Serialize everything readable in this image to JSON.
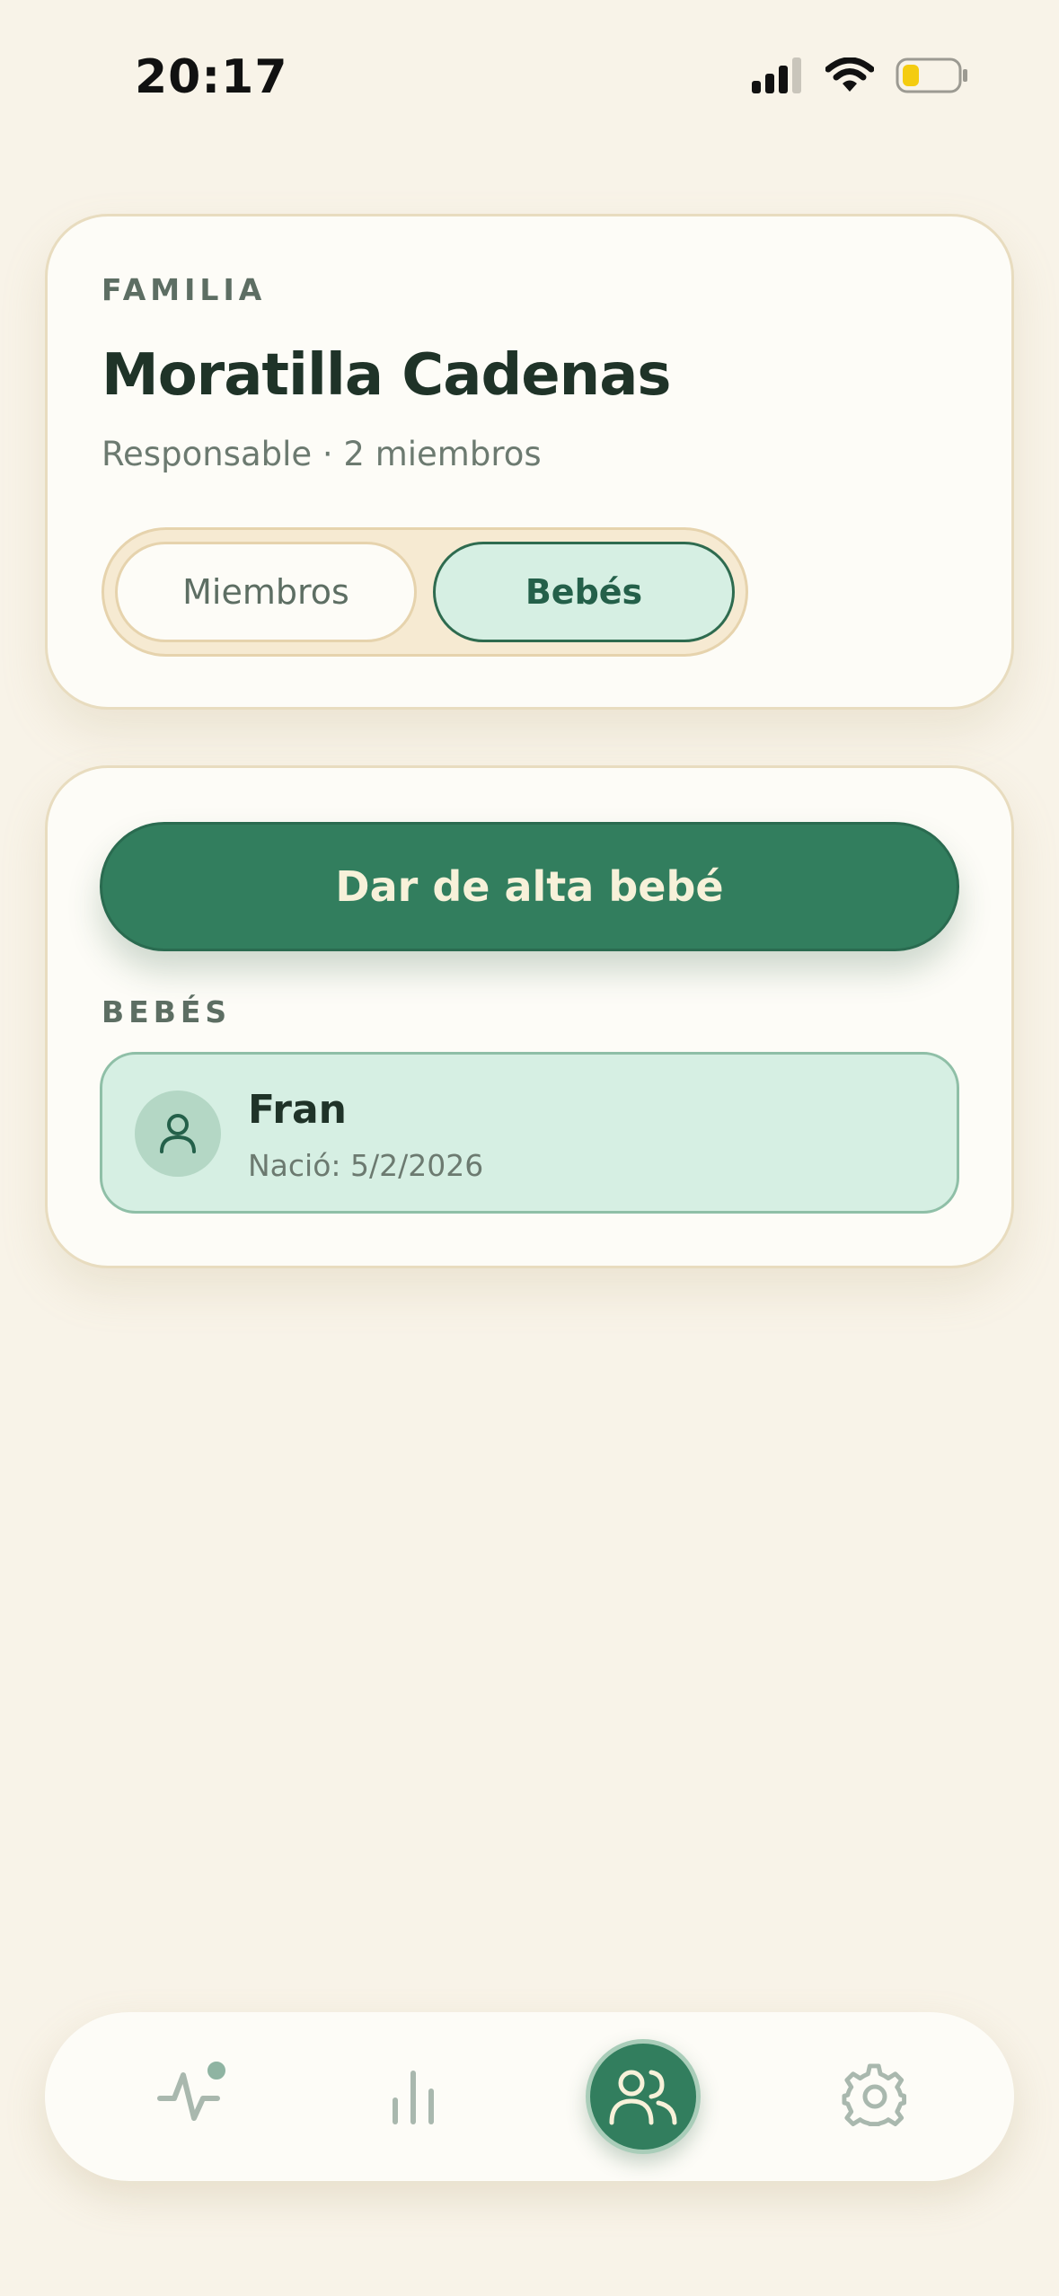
{
  "status_bar": {
    "time": "20:17",
    "icons": [
      "cellular-signal-icon",
      "wifi-icon",
      "battery-icon"
    ]
  },
  "family": {
    "eyebrow": "FAMILIA",
    "name": "Moratilla Cadenas",
    "subtitle": "Responsable · 2 miembros",
    "tabs": [
      {
        "label": "Miembros",
        "active": false
      },
      {
        "label": "Bebés",
        "active": true
      }
    ]
  },
  "babies": {
    "add_button_label": "Dar de alta bebé",
    "section_label": "BEBÉS",
    "items": [
      {
        "name": "Fran",
        "birth": "Nació: 5/2/2026",
        "icon": "person-icon"
      }
    ]
  },
  "nav": {
    "items": [
      {
        "icon": "activity-icon",
        "active": false,
        "badge": true
      },
      {
        "icon": "bar-chart-icon",
        "active": false
      },
      {
        "icon": "users-icon",
        "active": true
      },
      {
        "icon": "gear-icon",
        "active": false
      }
    ]
  },
  "colors": {
    "background": "#f8f3e8",
    "card": "#fdfcf7",
    "primary": "#327e5e",
    "accent_light": "#d6efe3",
    "border": "#e8dcbf",
    "text_dark": "#1f3328",
    "text_muted": "#6c7a70"
  }
}
